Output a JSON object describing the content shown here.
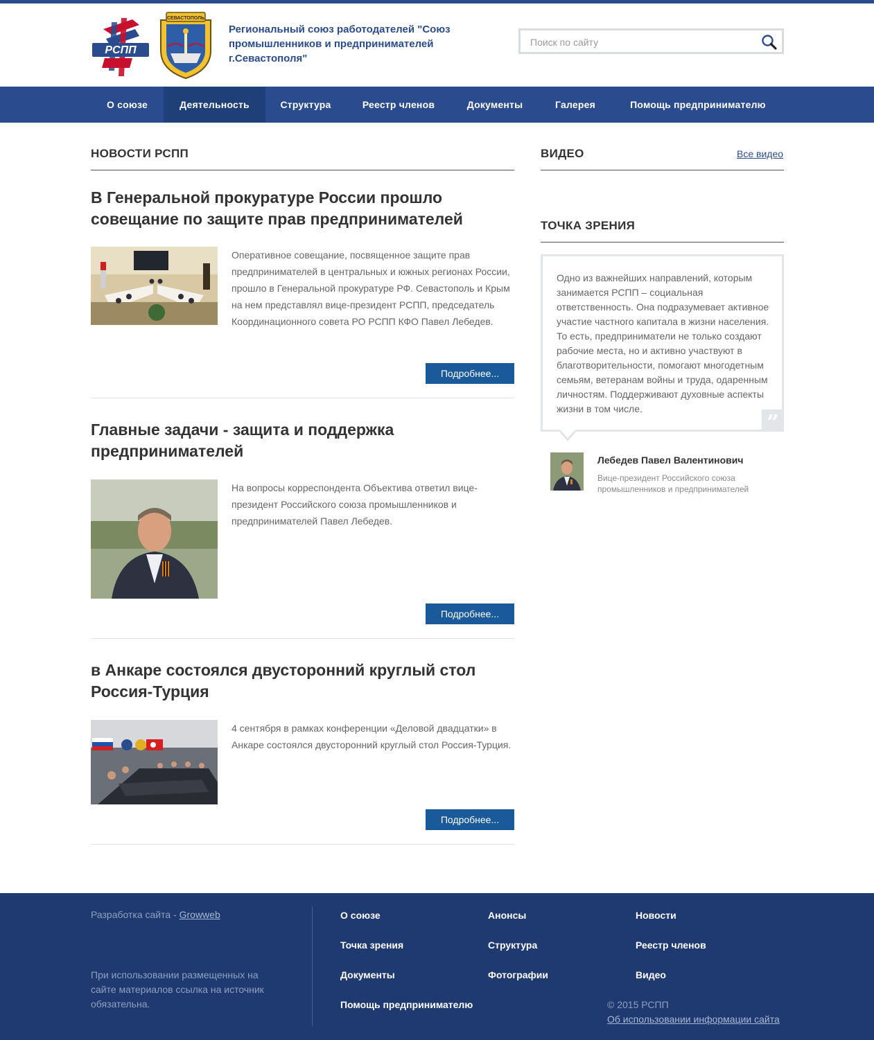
{
  "header": {
    "org_name": "Региональный союз работодателей \"Союз промышленников и предпринимателей г.Севастополя\"",
    "logo_text": "РСПП",
    "coat_text": "СЕВАСТОПОЛЬ",
    "search": {
      "placeholder": "Поиск по сайту"
    }
  },
  "nav": {
    "items": [
      {
        "label": "О союзе"
      },
      {
        "label": "Деятельность",
        "active": true
      },
      {
        "label": "Структура"
      },
      {
        "label": "Реестр членов"
      },
      {
        "label": "Документы"
      },
      {
        "label": "Галерея"
      },
      {
        "label": "Помощь предпринимателю"
      }
    ]
  },
  "news": {
    "section_title": "НОВОСТИ РСПП",
    "more_label": "Подробнее...",
    "items": [
      {
        "title": "В Генеральной прокуратуре России прошло совещание по защите прав предпринимателей",
        "text": "Оперативное совещание, посвященное защите прав предпринимателей в центральных и южных регионах России, прошло в Генеральной прокуратуре РФ. Севастополь и Крым на нем представлял вице-президент РСПП, председатель Координационного совета РО РСПП КФО Павел Лебедев."
      },
      {
        "title": "Главные задачи - защита и поддержка предпринимателей",
        "text": "На вопросы корреспондента Объектива ответил вице-президент Российского союза промышленников и предпринимателей Павел Лебедев."
      },
      {
        "title": "в Анкаре состоялся двусторонний круглый стол Россия-Турция",
        "text": "4 сентября в рамках конференции «Деловой двадцатки» в Анкаре состоялся двусторонний круглый стол Россия-Турция."
      }
    ]
  },
  "video": {
    "section_title": "ВИДЕО",
    "all_link": "Все видео"
  },
  "opinion": {
    "section_title": "ТОЧКА ЗРЕНИЯ",
    "quote": "Одно из важнейших направлений, которым занимается РСПП – социальная ответственность. Она подразумевает активное участие частного капитала в жизни населения. То есть, предприниматели не только создают рабочие места, но и активно участвуют в благотворительности, помогают многодетным семьям, ветеранам войны и труда, одаренным личностям. Поддерживают духовные аспекты жизни в том числе.",
    "author_name": "Лебедев Павел Валентинович",
    "author_position": "Вице-президент Российского союза промышленников и предпринимателей"
  },
  "footer": {
    "dev_prefix": "Разработка сайта - ",
    "dev_link": "Growweb",
    "note": "При использовании размещенных на сайте материалов ссылка на источник обязательна.",
    "links": [
      "О союзе",
      "Анонсы",
      "Новости",
      "Точка зрения",
      "Структура",
      "Реестр членов",
      "Документы",
      "Фотографии",
      "Видео",
      "Помощь предпринимателю"
    ],
    "copyright": "© 2015 РСПП",
    "usage_link": "Об использовании информации сайта"
  },
  "colors": {
    "brand": "#2a4b8d",
    "nav_active": "#1f3f78",
    "button": "#1a5a9a",
    "footer": "#1f3a70"
  }
}
